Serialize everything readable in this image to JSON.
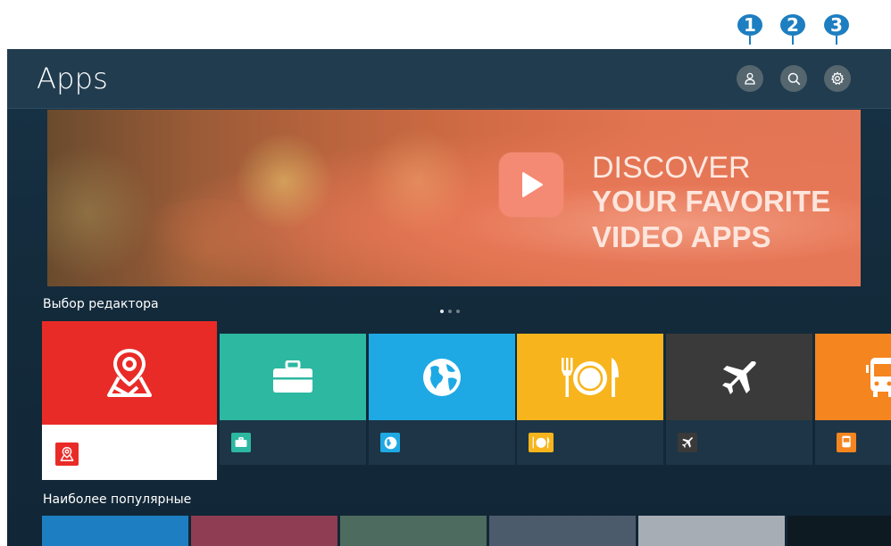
{
  "callouts": [
    "1",
    "2",
    "3"
  ],
  "header": {
    "title": "Apps",
    "buttons": [
      {
        "name": "account",
        "icon": "person-icon"
      },
      {
        "name": "search",
        "icon": "search-icon"
      },
      {
        "name": "settings",
        "icon": "gear-icon"
      }
    ]
  },
  "banner": {
    "line1": "DISCOVER",
    "line2": "YOUR FAVORITE",
    "line3": "VIDEO APPS",
    "icon": "play-icon"
  },
  "sections": {
    "editors_choice": "Выбор редактора",
    "most_popular": "Наиболее популярные"
  },
  "carousel": {
    "pages": 3,
    "active": 1
  },
  "tiles": [
    {
      "name": "map",
      "icon": "map-pin-icon",
      "color": "#e92b27"
    },
    {
      "name": "business",
      "icon": "briefcase-icon",
      "color": "#2db8a1"
    },
    {
      "name": "world",
      "icon": "globe-icon",
      "color": "#1fa9e4"
    },
    {
      "name": "food",
      "icon": "dining-icon",
      "color": "#f7b41d"
    },
    {
      "name": "travel",
      "icon": "airplane-icon",
      "color": "#3a3a3a"
    },
    {
      "name": "transport",
      "icon": "bus-icon",
      "color": "#f5851f"
    }
  ],
  "popular_thumbs": [
    "#1d7ec1",
    "#8f3d52",
    "#4e6b5f",
    "#4c5b6c",
    "#a6adb4",
    "#0e1a22"
  ]
}
